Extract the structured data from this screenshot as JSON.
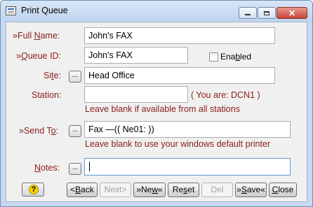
{
  "window": {
    "title": "Print Queue",
    "icon": "print-queue-icon"
  },
  "form": {
    "full_name": {
      "label_pre": "»Full ",
      "label_key": "N",
      "label_post": "ame:",
      "value": "John's FAX"
    },
    "queue_id": {
      "label_pre": "»",
      "label_key": "Q",
      "label_post": "ueue ID:",
      "value": "John's FAX"
    },
    "enabled": {
      "label_pre": "Ena",
      "label_key": "b",
      "label_post": "led",
      "checked": false
    },
    "site": {
      "label_pre": "Si",
      "label_key": "t",
      "label_post": "e:",
      "value": "Head Office",
      "browse": "..."
    },
    "station": {
      "label": "Station:",
      "value": "",
      "you_are": "( You are: DCN1 )",
      "hint": "Leave blank if available from all stations"
    },
    "send_to": {
      "label_pre": "»Send T",
      "label_key": "o",
      "label_post": ":",
      "value": "Fax  —(( Ne01: ))",
      "browse": "...",
      "hint": "Leave blank to use your windows default printer"
    },
    "notes": {
      "label_pre": "",
      "label_key": "N",
      "label_post": "otes:",
      "value": "",
      "button": "..."
    }
  },
  "buttons": {
    "back": {
      "pre": "<",
      "key": "B",
      "post": "ack"
    },
    "next": {
      "label": "Next>"
    },
    "new": {
      "pre": "»Ne",
      "key": "w",
      "post": "«"
    },
    "reset": {
      "pre": "Re",
      "key": "s",
      "post": "et"
    },
    "del": {
      "label": "Del"
    },
    "save": {
      "pre": "»",
      "key": "S",
      "post": "ave«"
    },
    "close": {
      "pre": "",
      "key": "C",
      "post": "lose"
    }
  },
  "colors": {
    "label": "#8a1c1c",
    "frame": "#c8daf0",
    "client": "#f0f0f0"
  }
}
